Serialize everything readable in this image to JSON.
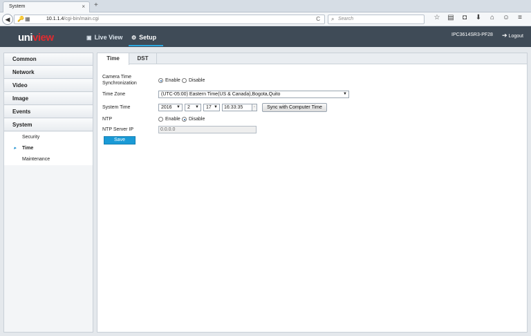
{
  "browser": {
    "tab_title": "System",
    "tab_close": "×",
    "new_tab": "+",
    "back": "◀",
    "url_icons": "🔑▦",
    "url_host": "10.1.1.4",
    "url_path": "/cgi-bin/main.cgi",
    "reload": "C",
    "search_placeholder": "Search",
    "icons": [
      "star-icon",
      "clipboard-icon",
      "pocket-icon",
      "download-icon",
      "home-icon",
      "chat-icon",
      "menu-icon"
    ],
    "icon_glyphs": [
      "☆",
      "▤",
      "◘",
      "⬇",
      "⌂",
      "☺",
      "≡"
    ]
  },
  "header": {
    "logo_a": "uni",
    "logo_b": "view",
    "nav": [
      {
        "label": "Live View",
        "icon": "▣"
      },
      {
        "label": "Setup",
        "icon": "⚙"
      }
    ],
    "device_name": "IPC3614SR3-PF28",
    "logout_label": "Logout",
    "logout_icon": "➔"
  },
  "sidebar": {
    "sections": [
      "Common",
      "Network",
      "Video",
      "Image",
      "Events",
      "System"
    ],
    "subitems": [
      "Security",
      "Time",
      "Maintenance"
    ],
    "active_sub": "Time",
    "arrow": "▸"
  },
  "tabs": [
    "Time",
    "DST"
  ],
  "form": {
    "sync_label_line1": "Camera Time",
    "sync_label_line2": "Synchronization",
    "sync_enable": "Enable",
    "sync_disable": "Disable",
    "timezone_label": "Time Zone",
    "timezone_value": "(UTC-05:00) Eastern Time(US & Canada),Bogota,Quito",
    "systemtime_label": "System Time",
    "year": "2016",
    "month": "2",
    "day": "17",
    "time": "16:33:35",
    "sync_button": "Sync with Computer Time",
    "ntp_label": "NTP",
    "ntp_enable": "Enable",
    "ntp_disable": "Disable",
    "ntp_server_label": "NTP Server IP",
    "ntp_server_value": "0.0.0.0",
    "save_button": "Save",
    "dropdown_arrow": "▼",
    "spin_glyph": "▫"
  },
  "colors": {
    "header_bg": "#3f4b57",
    "accent": "#2ca8e0",
    "save_bg": "#1a9ad6",
    "logo_red": "#e02b30"
  }
}
